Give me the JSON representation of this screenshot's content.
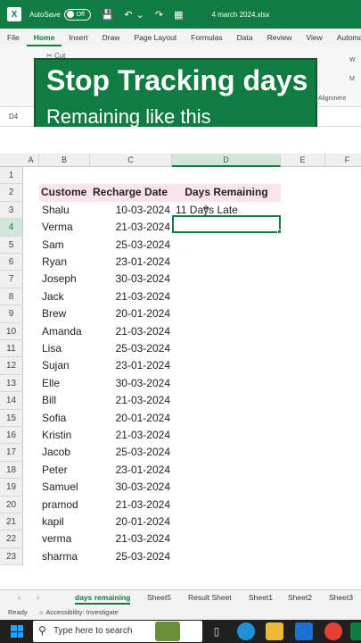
{
  "titlebar": {
    "autosave_label": "AutoSave",
    "autosave_state": "Off",
    "filename": "4 march 2024.xlsx"
  },
  "ribbon": {
    "tabs": [
      "File",
      "Home",
      "Insert",
      "Draw",
      "Page Layout",
      "Formulas",
      "Data",
      "Review",
      "View",
      "Automate"
    ],
    "active_tab": "Home",
    "cut_label": "Cut",
    "alignment_label": "Alignment",
    "right_labels": [
      "W",
      "M"
    ]
  },
  "banner": {
    "line1": "Stop Tracking days",
    "line2": "Remaining like this"
  },
  "formula_bar": {
    "name_box": "D4"
  },
  "grid": {
    "columns": [
      "A",
      "B",
      "C",
      "D",
      "E",
      "F"
    ],
    "selected_column": "D",
    "rows": [
      "1",
      "2",
      "3",
      "4",
      "5",
      "6",
      "7",
      "8",
      "9",
      "10",
      "11",
      "12",
      "13",
      "14",
      "15",
      "16",
      "17",
      "18",
      "19",
      "20",
      "21",
      "22",
      "23"
    ],
    "selected_row": "4",
    "headers": {
      "customer": "Custome",
      "recharge_date": "Recharge Date",
      "days_remaining": "Days Remaining"
    },
    "records": [
      {
        "name": "Shalu",
        "date": "10-03-2024",
        "days": "11 Days Late"
      },
      {
        "name": "Verma",
        "date": "21-03-2024",
        "days": ""
      },
      {
        "name": "Sam",
        "date": "25-03-2024",
        "days": ""
      },
      {
        "name": "Ryan",
        "date": "23-01-2024",
        "days": ""
      },
      {
        "name": "Joseph",
        "date": "30-03-2024",
        "days": ""
      },
      {
        "name": "Jack",
        "date": "21-03-2024",
        "days": ""
      },
      {
        "name": "Brew",
        "date": "20-01-2024",
        "days": ""
      },
      {
        "name": "Amanda",
        "date": "21-03-2024",
        "days": ""
      },
      {
        "name": "Lisa",
        "date": "25-03-2024",
        "days": ""
      },
      {
        "name": "Sujan",
        "date": "23-01-2024",
        "days": ""
      },
      {
        "name": "Elle",
        "date": "30-03-2024",
        "days": ""
      },
      {
        "name": "Bill",
        "date": "21-03-2024",
        "days": ""
      },
      {
        "name": "Sofia",
        "date": "20-01-2024",
        "days": ""
      },
      {
        "name": "Kristin",
        "date": "21-03-2024",
        "days": ""
      },
      {
        "name": "Jacob",
        "date": "25-03-2024",
        "days": ""
      },
      {
        "name": "Peter",
        "date": "23-01-2024",
        "days": ""
      },
      {
        "name": "Samuel",
        "date": "30-03-2024",
        "days": ""
      },
      {
        "name": "pramod",
        "date": "21-03-2024",
        "days": ""
      },
      {
        "name": "kapil",
        "date": "20-01-2024",
        "days": ""
      },
      {
        "name": "verma",
        "date": "21-03-2024",
        "days": ""
      },
      {
        "name": "sharma",
        "date": "25-03-2024",
        "days": ""
      }
    ]
  },
  "sheets": {
    "tabs": [
      "days remaining",
      "Sheet5",
      "Result Sheet",
      "Sheet1",
      "Sheet2",
      "Sheet3"
    ],
    "active": "days remaining"
  },
  "status": {
    "ready": "Ready",
    "accessibility": "Accessibility: Investigate"
  },
  "taskbar": {
    "search_placeholder": "Type here to search"
  },
  "colors": {
    "excel_green": "#107c41",
    "header_pink": "#fce4ef"
  }
}
